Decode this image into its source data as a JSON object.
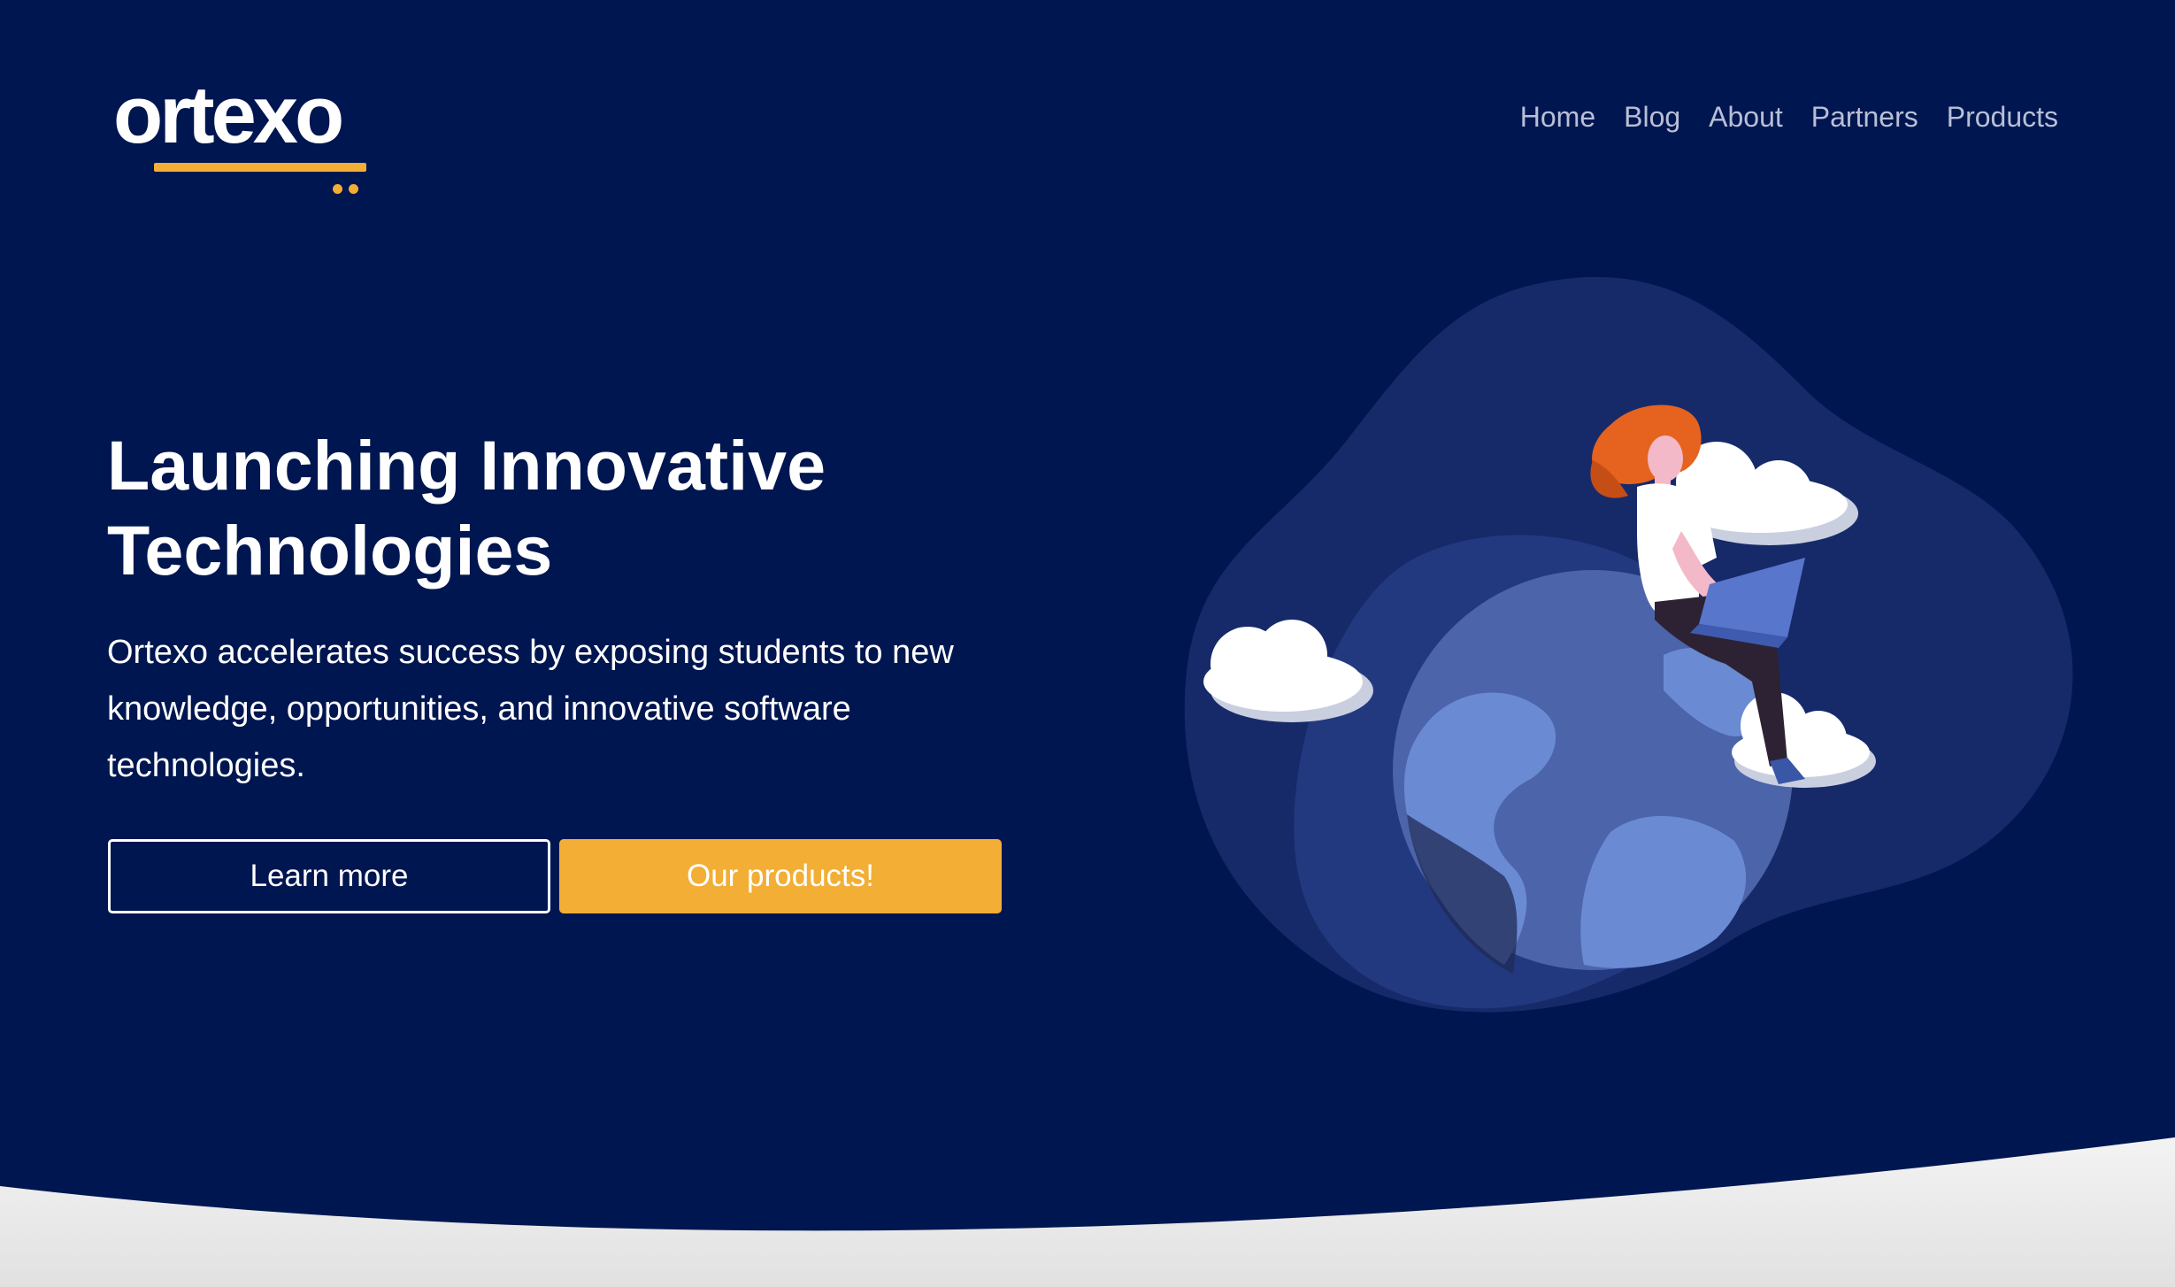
{
  "brand": {
    "logo_text": "ortexo",
    "accent_color": "#f2ae35",
    "background_color": "#001650"
  },
  "nav": {
    "items": [
      {
        "label": "Home"
      },
      {
        "label": "Blog"
      },
      {
        "label": "About"
      },
      {
        "label": "Partners"
      },
      {
        "label": "Products"
      }
    ]
  },
  "hero": {
    "headline_line1": "Launching Innovative",
    "headline_line2": "Technologies",
    "description": "Ortexo accelerates success by exposing students to new knowledge, opportunities, and innovative software technologies.",
    "learn_more_label": "Learn more",
    "products_label": "Our products!"
  },
  "illustration": {
    "icon": "person-on-globe-with-laptop-illustration"
  }
}
